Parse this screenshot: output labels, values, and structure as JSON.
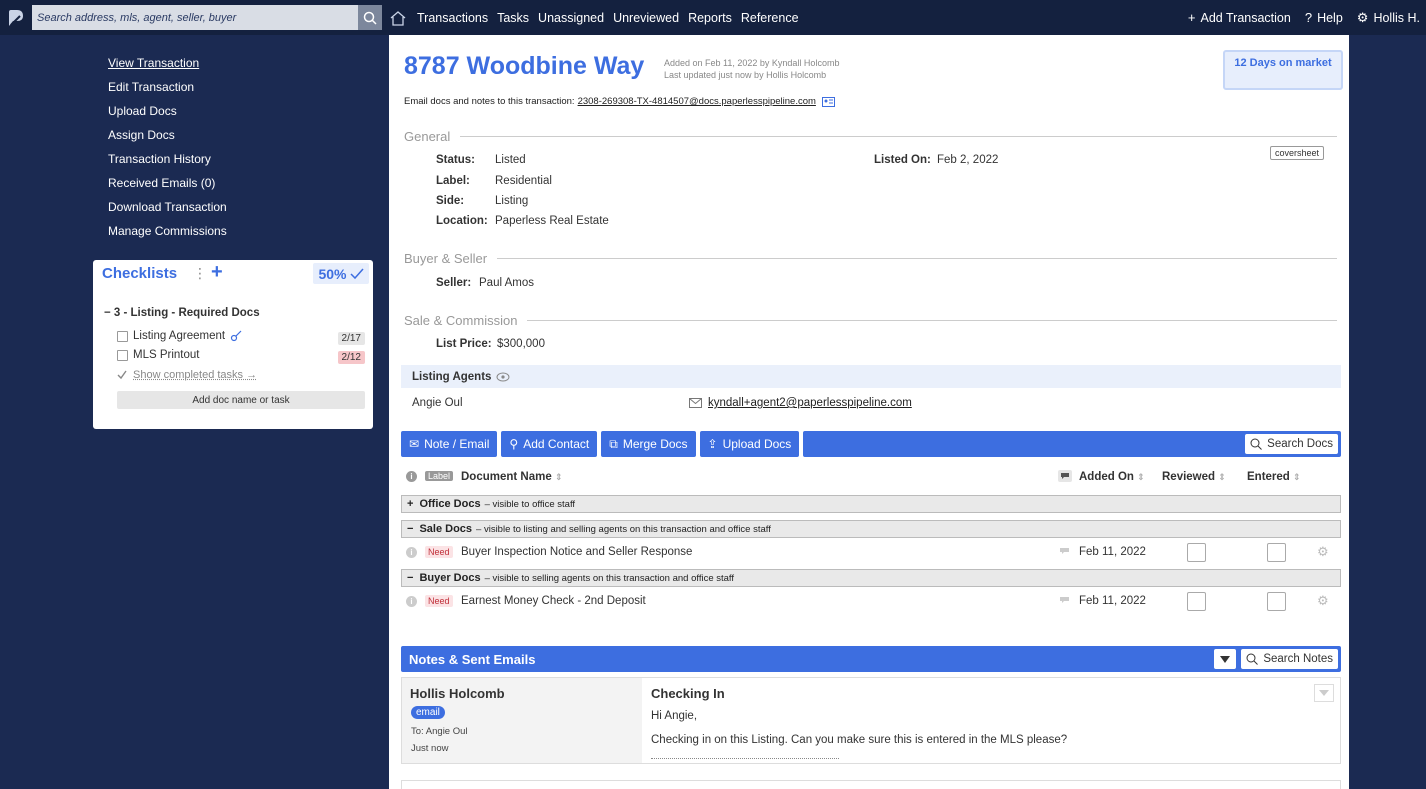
{
  "search": {
    "placeholder": "Search address, mls, agent, seller, buyer"
  },
  "nav": {
    "items": [
      "Transactions",
      "Tasks",
      "Unassigned",
      "Unreviewed",
      "Reports",
      "Reference"
    ],
    "add_transaction": "Add Transaction",
    "help": "Help",
    "user": "Hollis H."
  },
  "sidebar": {
    "links": [
      "View Transaction",
      "Edit Transaction",
      "Upload Docs",
      "Assign Docs",
      "Transaction History",
      "Received Emails (0)",
      "Download Transaction",
      "Manage Commissions"
    ]
  },
  "checklists": {
    "title": "Checklists",
    "percent": "50%",
    "group": "3 - Listing - Required Docs",
    "items": [
      {
        "label": "Listing Agreement",
        "count": "2/17"
      },
      {
        "label": "MLS Printout",
        "count": "2/12"
      }
    ],
    "show_completed": "Show completed tasks →",
    "add_placeholder": "Add doc name or task"
  },
  "transaction": {
    "address": "8787 Woodbine Way",
    "added_on": "Added on Feb 11, 2022 by Kyndall Holcomb",
    "updated": "Last updated just now by Hollis Holcomb",
    "days_on_market": "12 Days on market",
    "email_prefix": "Email docs and notes to this transaction:",
    "email_address": "2308-269308-TX-4814507@docs.paperlesspipeline.com",
    "coversheet": "coversheet"
  },
  "general": {
    "heading": "General",
    "status_label": "Status:",
    "status": "Listed",
    "label_label": "Label:",
    "label": "Residential",
    "side_label": "Side:",
    "side": "Listing",
    "location_label": "Location:",
    "location": "Paperless Real Estate",
    "listed_on_label": "Listed On:",
    "listed_on": "Feb 2, 2022"
  },
  "buyer_seller": {
    "heading": "Buyer & Seller",
    "seller_label": "Seller:",
    "seller": "Paul Amos"
  },
  "sale_commission": {
    "heading": "Sale & Commission",
    "list_price_label": "List Price:",
    "list_price": "$300,000"
  },
  "listing_agents": {
    "heading": "Listing Agents",
    "name": "Angie Oul",
    "email": "kyndall+agent2@paperlesspipeline.com"
  },
  "toolbar": {
    "note_email": "Note / Email",
    "add_contact": "Add Contact",
    "merge_docs": "Merge Docs",
    "upload_docs": "Upload Docs",
    "search_docs": "Search Docs"
  },
  "docs_table": {
    "label_tag": "Label",
    "col_name": "Document Name",
    "col_added": "Added On",
    "col_reviewed": "Reviewed",
    "col_entered": "Entered",
    "groups": [
      {
        "sign": "+",
        "name": "Office Docs",
        "desc": "– visible to office staff"
      },
      {
        "sign": "−",
        "name": "Sale Docs",
        "desc": "– visible to listing and selling agents on this transaction and office staff"
      },
      {
        "sign": "−",
        "name": "Buyer Docs",
        "desc": "– visible to selling agents on this transaction and office staff"
      }
    ],
    "rows": [
      {
        "tag": "Need",
        "name": "Buyer Inspection Notice and Seller Response",
        "added": "Feb 11, 2022"
      },
      {
        "tag": "Need",
        "name": "Earnest Money Check - 2nd Deposit",
        "added": "Feb 11, 2022"
      }
    ]
  },
  "notes": {
    "heading": "Notes & Sent Emails",
    "search": "Search Notes",
    "entry": {
      "author": "Hollis Holcomb",
      "type": "email",
      "to": "To: Angie Oul",
      "when": "Just now",
      "subject": "Checking In",
      "greeting": "Hi Angie,",
      "body": "Checking in on this Listing. Can you make sure this is entered in the MLS please?"
    }
  }
}
